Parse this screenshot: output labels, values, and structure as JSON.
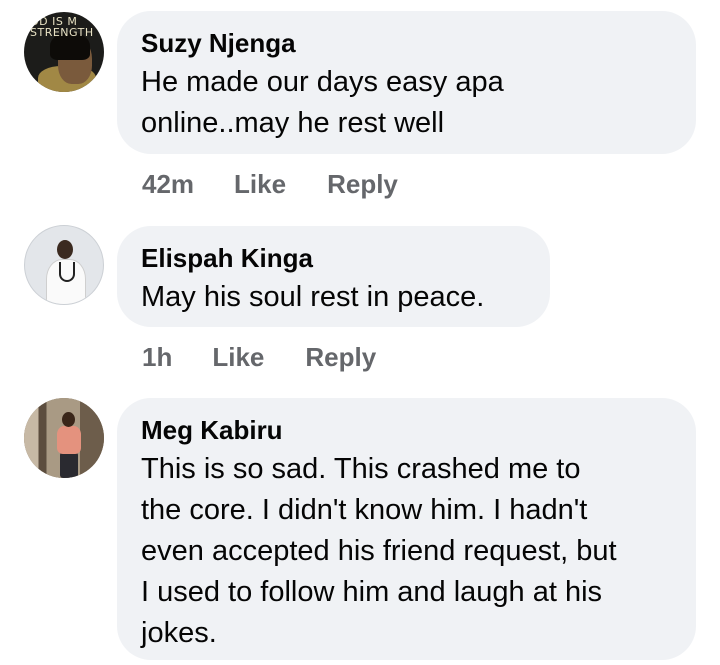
{
  "comments": [
    {
      "avatar_text": "OD IS M\nSTRENGTH",
      "author": "Suzy Njenga",
      "lines": [
        "He made our days easy apa",
        "online..may he rest well"
      ],
      "time": "42m",
      "like_label": "Like",
      "reply_label": "Reply"
    },
    {
      "author": "Elispah Kinga",
      "lines": [
        "May his soul rest in peace."
      ],
      "time": "1h",
      "like_label": "Like",
      "reply_label": "Reply"
    },
    {
      "author": "Meg Kabiru",
      "lines": [
        "This is so sad. This crashed me to",
        "the core. I didn't know him. I hadn't",
        "even accepted his friend request, but",
        "I used to follow him and laugh at his",
        "jokes."
      ]
    }
  ],
  "colors": {
    "bubble_bg": "#f0f2f5",
    "text": "#050505",
    "secondary_text": "#65676b"
  }
}
